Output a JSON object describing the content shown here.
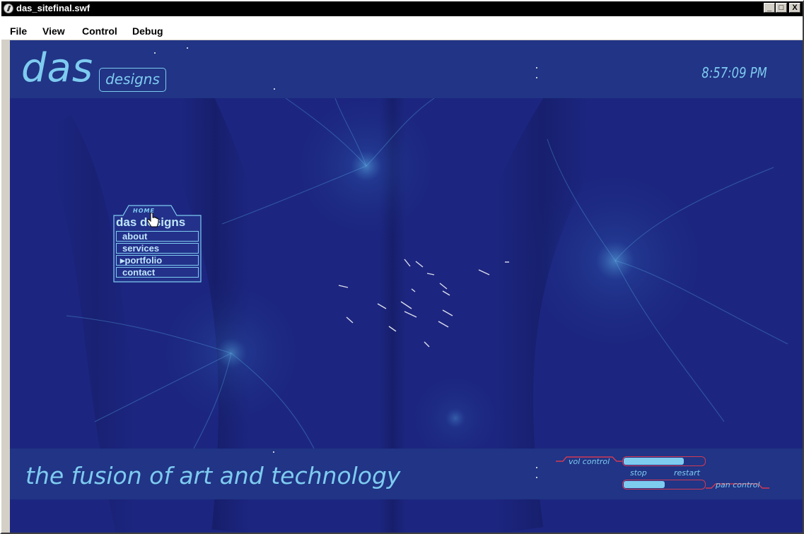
{
  "window": {
    "title": "das_sitefinal.swf",
    "buttons": {
      "minimize": "_",
      "maximize": "□",
      "close": "X"
    }
  },
  "menubar": {
    "items": [
      "File",
      "View",
      "Control",
      "Debug"
    ]
  },
  "site": {
    "logo_main": "das",
    "logo_sub": "designs",
    "clock": "8:57:09 PM",
    "tagline": "the fusion of art and technology",
    "nav": {
      "tab_label": "HOME",
      "heading": "das designs",
      "items": [
        "about",
        "services",
        "▸portfolio",
        "contact"
      ]
    },
    "controls": {
      "vol_label": "vol control",
      "vol_level": 0.73,
      "stop_label": "stop",
      "restart_label": "restart",
      "pan_label": "pan control",
      "pan_level": 0.5
    }
  },
  "colors": {
    "background": "#1a237a",
    "band": "#213485",
    "accent": "#7ecbf0",
    "control_outline": "#d23a55"
  }
}
